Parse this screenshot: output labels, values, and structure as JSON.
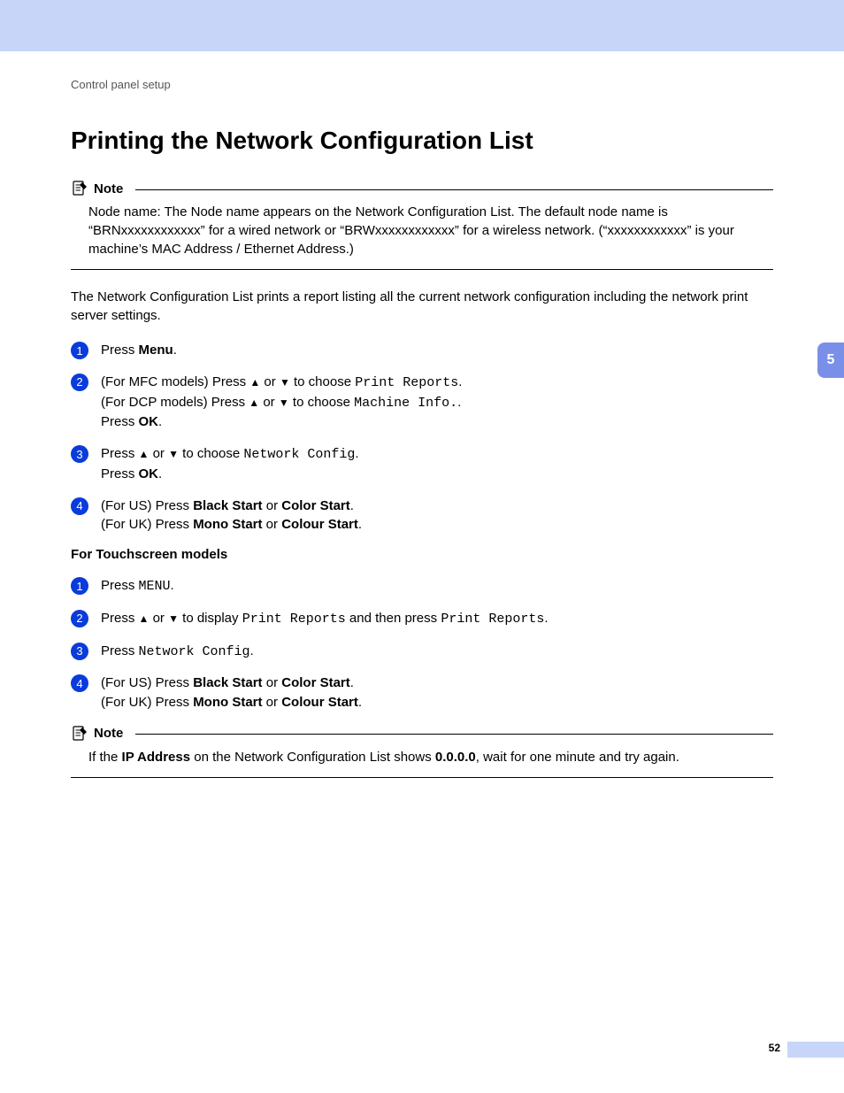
{
  "header_bar": {},
  "breadcrumb": "Control panel setup",
  "title": "Printing the Network Configuration List",
  "note1": {
    "label": "Note",
    "body": "Node name: The Node name appears on the Network Configuration List. The default node name is “BRNxxxxxxxxxxxx” for a wired network or “BRWxxxxxxxxxxxx” for a wireless network. (“xxxxxxxxxxxx” is your machine’s MAC Address / Ethernet Address.)"
  },
  "intro": "The Network Configuration List prints a report listing all the current network configuration including the network print server settings.",
  "stepsA": {
    "s1": {
      "prefix": "Press ",
      "bold1": "Menu",
      "suffix": "."
    },
    "s2": {
      "line1_a": "(For MFC models) Press ",
      "line1_b": " or ",
      "line1_c": " to choose ",
      "line1_mono": "Print Reports",
      "line1_d": ".",
      "line2_a": "(For DCP models) Press ",
      "line2_b": " or ",
      "line2_c": " to choose ",
      "line2_mono": "Machine Info.",
      "line2_d": ".",
      "line3_a": "Press ",
      "line3_bold": "OK",
      "line3_b": "."
    },
    "s3": {
      "line1_a": "Press ",
      "line1_b": " or ",
      "line1_c": " to choose ",
      "line1_mono": "Network Config",
      "line1_d": ".",
      "line2_a": "Press ",
      "line2_bold": "OK",
      "line2_b": "."
    },
    "s4": {
      "line1_a": "(For US) Press ",
      "line1_b1": "Black Start",
      "line1_mid": " or ",
      "line1_b2": "Color Start",
      "line1_end": ".",
      "line2_a": "(For UK) Press ",
      "line2_b1": "Mono Start",
      "line2_mid": " or ",
      "line2_b2": "Colour Start",
      "line2_end": "."
    }
  },
  "subhead": "For Touchscreen models",
  "stepsB": {
    "s1": {
      "prefix": "Press ",
      "mono": "MENU",
      "suffix": "."
    },
    "s2": {
      "a": "Press ",
      "b": " or ",
      "c": " to display ",
      "mono1": "Print Reports",
      "d": " and then press ",
      "mono2": "Print Reports",
      "e": "."
    },
    "s3": {
      "a": "Press ",
      "mono": "Network Config",
      "b": "."
    },
    "s4": {
      "line1_a": "(For US) Press ",
      "line1_b1": "Black Start",
      "line1_mid": " or ",
      "line1_b2": "Color Start",
      "line1_end": ".",
      "line2_a": "(For UK) Press ",
      "line2_b1": "Mono Start",
      "line2_mid": " or ",
      "line2_b2": "Colour Start",
      "line2_end": "."
    }
  },
  "note2": {
    "label": "Note",
    "a": "If the ",
    "b1": "IP Address",
    "b": " on the Network Configuration List shows ",
    "b2": "0.0.0.0",
    "c": ", wait for one minute and try again."
  },
  "tab": "5",
  "page": "52",
  "bullets": {
    "n1": "1",
    "n2": "2",
    "n3": "3",
    "n4": "4"
  },
  "arrows": {
    "up": "▲",
    "down": "▼"
  }
}
